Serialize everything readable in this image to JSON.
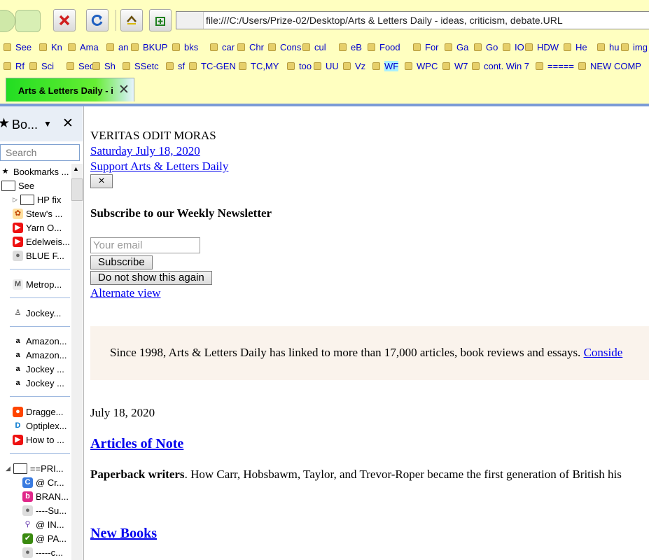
{
  "toolbar": {
    "url": "file:///C:/Users/Prize-02/Desktop/Arts & Letters Daily - ideas, criticism, debate.URL"
  },
  "bookmarks_row1": [
    "See",
    "Kn",
    "Ama",
    "an",
    "BKUP",
    "bks",
    "car",
    "Chr",
    "Cons",
    "cul",
    "eB",
    "Food",
    "For",
    "Ga",
    "Go",
    "IO",
    "HDW",
    "He",
    "hu",
    "img"
  ],
  "bookmarks_row2": [
    "Rf",
    "Sci",
    "Sec",
    "Sh",
    "SSetc",
    "sf",
    "TC-GEN",
    "TC,MY",
    "too",
    "UU",
    "Vz",
    "WF",
    "WPC",
    "W7",
    "cont. Win 7",
    "=====",
    "NEW COMP"
  ],
  "tab": {
    "title": "Arts & Letters Daily - i"
  },
  "sidebar": {
    "title": "Bo...",
    "search_placeholder": "Search",
    "items": [
      "Bookmarks ...",
      "See",
      "HP fix",
      "Stew's ...",
      "Yarn O...",
      "Edelweis...",
      "BLUE F...",
      "Metrop...",
      "Jockey...",
      "Amazon...",
      "Amazon...",
      "Jockey ...",
      "Jockey ...",
      "Dragge...",
      "Optiplex...",
      "How to ...",
      "==PRI...",
      "@ Cr...",
      "BRAN...",
      "----Su...",
      "@ IN...",
      "@ PA...",
      "-----c..."
    ]
  },
  "page": {
    "motto": "VERITAS ODIT MORAS",
    "date_link": "Saturday July 18, 2020",
    "support_link": "Support Arts & Letters Daily",
    "close_label": "×",
    "subscribe_heading": "Subscribe to our Weekly Newsletter",
    "email_placeholder": "Your email",
    "subscribe_button": "Subscribe",
    "dismiss_button": "Do not show this again",
    "alternate_link": "Alternate view",
    "banner_text": "Since 1998, Arts & Letters Daily has linked to more than 17,000 articles, book reviews and essays.",
    "banner_link": "Conside",
    "date": "July 18, 2020",
    "articles_heading": "Articles of Note",
    "article_title": "Paperback writers",
    "article_text": ". How Carr, Hobsbawm, Taylor, and Trevor-Roper became the first generation of British his",
    "new_books_heading": "New Books"
  }
}
